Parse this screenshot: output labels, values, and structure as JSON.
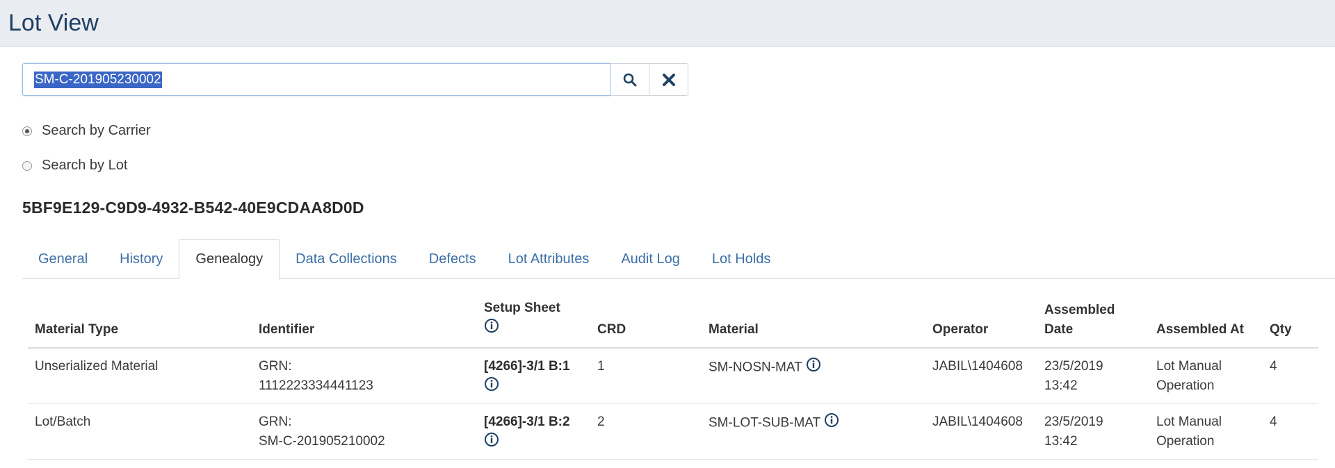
{
  "page": {
    "title": "Lot View"
  },
  "search": {
    "value": "SM-C-201905230002",
    "search_icon": "search-icon",
    "clear_icon": "close-icon"
  },
  "radios": [
    {
      "label": "Search by Carrier",
      "checked": true
    },
    {
      "label": "Search by Lot",
      "checked": false
    }
  ],
  "lot_guid": "5BF9E129-C9D9-4932-B542-40E9CDAA8D0D",
  "tabs": {
    "general": "General",
    "history": "History",
    "genealogy": "Genealogy",
    "data_collections": "Data Collections",
    "defects": "Defects",
    "lot_attributes": "Lot Attributes",
    "audit_log": "Audit Log",
    "lot_holds": "Lot Holds",
    "active": "Genealogy"
  },
  "table": {
    "headers": {
      "material_type": "Material Type",
      "identifier": "Identifier",
      "setup_sheet": "Setup Sheet",
      "crd": "CRD",
      "material": "Material",
      "operator": "Operator",
      "assembled_date_1": "Assembled",
      "assembled_date_2": "Date",
      "assembled_at": "Assembled At",
      "qty": "Qty"
    },
    "rows": [
      {
        "material_type": "Unserialized Material",
        "identifier_1": "GRN:",
        "identifier_2": "1112223334441123",
        "setup_sheet": "[4266]-3/1 B:1",
        "crd": "1",
        "material": "SM-NOSN-MAT",
        "operator": "JABIL\\1404608",
        "date_1": "23/5/2019",
        "date_2": "13:42",
        "assembled_at_1": "Lot Manual",
        "assembled_at_2": "Operation",
        "qty": "4"
      },
      {
        "material_type": "Lot/Batch",
        "identifier_1": "GRN:",
        "identifier_2": "SM-C-201905210002",
        "setup_sheet": "[4266]-3/1 B:2",
        "crd": "2",
        "material": "SM-LOT-SUB-MAT",
        "operator": "JABIL\\1404608",
        "date_1": "23/5/2019",
        "date_2": "13:42",
        "assembled_at_1": "Lot Manual",
        "assembled_at_2": "Operation",
        "qty": "4"
      }
    ]
  },
  "colors": {
    "accent": "#1f3f63",
    "link": "#3c6fa6",
    "header_bg": "#e9edf2",
    "selection": "#3a66c6"
  }
}
